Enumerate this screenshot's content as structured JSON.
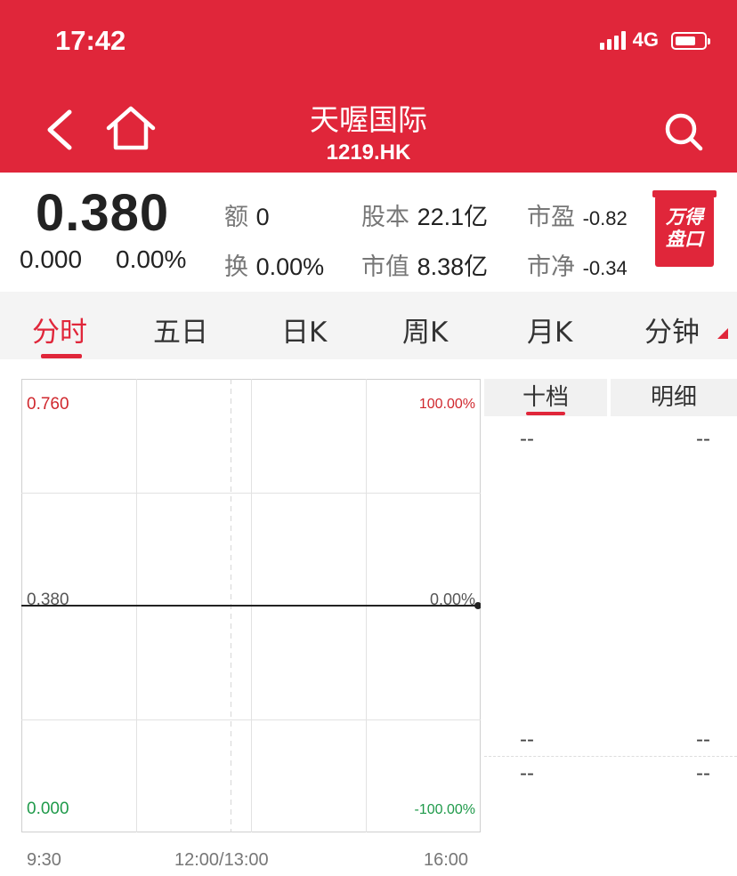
{
  "status_bar": {
    "time": "17:42",
    "network": "4G"
  },
  "header": {
    "title": "天喔国际",
    "code": "1219.HK"
  },
  "quote": {
    "price": "0.380",
    "change": "0.000",
    "change_pct": "0.00%",
    "amount_label": "额",
    "amount_value": "0",
    "turnover_label": "换",
    "turnover_value": "0.00%",
    "share_capital_label": "股本",
    "share_capital_value": "22.1亿",
    "market_value_label": "市值",
    "market_value_value": "8.38亿",
    "pe_label": "市盈",
    "pe_value": "-0.82",
    "pb_label": "市净",
    "pb_value": "-0.34",
    "badge_line1": "万得",
    "badge_line2": "盘口"
  },
  "tabs": [
    {
      "label": "分时",
      "active": true
    },
    {
      "label": "五日",
      "active": false
    },
    {
      "label": "日K",
      "active": false
    },
    {
      "label": "周K",
      "active": false
    },
    {
      "label": "月K",
      "active": false
    },
    {
      "label": "分钟",
      "active": false
    }
  ],
  "chart": {
    "y_left_top": "0.760",
    "y_left_mid": "0.380",
    "y_left_bottom": "0.000",
    "y_right_top": "100.00%",
    "y_right_mid": "0.00%",
    "y_right_bottom": "-100.00%",
    "x_labels": [
      "9:30",
      "12:00/13:00",
      "16:00"
    ],
    "colors": {
      "up": "#d0282e",
      "down": "#1f9a4a",
      "neutral": "#555555"
    }
  },
  "chart_data": {
    "type": "line",
    "x": [
      "9:30",
      "16:00"
    ],
    "series": [
      {
        "values": [
          0.38,
          0.38
        ]
      }
    ],
    "ylim": [
      0.0,
      0.76
    ],
    "y2_labels": [
      "100.00%",
      "0.00%",
      "-100.00%"
    ],
    "grid": true
  },
  "order_book": {
    "tabs": [
      "十档",
      "明细"
    ],
    "placeholder": "--"
  },
  "colors": {
    "brand_red": "#e0263a"
  }
}
